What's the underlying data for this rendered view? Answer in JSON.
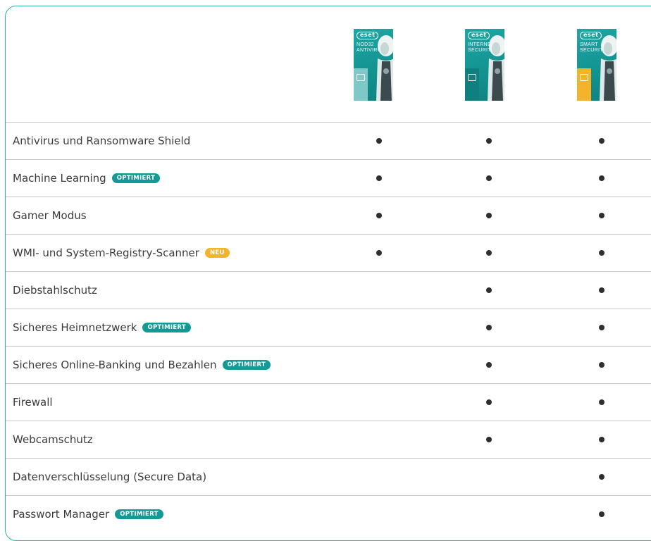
{
  "products": [
    {
      "name": "nod32",
      "logo": "eset",
      "title_lines": [
        "NOD32",
        "ANTIVIRUS"
      ],
      "strip_color": "#7fc7c8",
      "icon": "laptop-icon"
    },
    {
      "name": "internet-security",
      "logo": "eset",
      "title_lines": [
        "INTERNET",
        "SECURITY"
      ],
      "strip_color": "#0f807d",
      "icon": "shield-window-icon"
    },
    {
      "name": "smart-security",
      "logo": "eset",
      "title_lines": [
        "SMART",
        "SECURITY"
      ],
      "strip_color": "#f3b32b",
      "icon": "shield-window-icon"
    }
  ],
  "colors": {
    "accent": "#2bb2a9",
    "badge_teal": "#139a97",
    "badge_yellow": "#f3b32b"
  },
  "rows": [
    {
      "label": "Antivirus und Ransomware Shield",
      "badge": "",
      "badge_color": "",
      "marks": [
        true,
        true,
        true
      ]
    },
    {
      "label": "Machine Learning",
      "badge": "OPTIMIERT",
      "badge_color": "#139a97",
      "marks": [
        true,
        true,
        true
      ]
    },
    {
      "label": "Gamer Modus",
      "badge": "",
      "badge_color": "",
      "marks": [
        true,
        true,
        true
      ]
    },
    {
      "label": "WMI- und System-Registry-Scanner",
      "badge": "NEU",
      "badge_color": "#f3b32b",
      "marks": [
        true,
        true,
        true
      ]
    },
    {
      "label": "Diebstahlschutz",
      "badge": "",
      "badge_color": "",
      "marks": [
        false,
        true,
        true
      ]
    },
    {
      "label": "Sicheres Heimnetzwerk",
      "badge": "OPTIMIERT",
      "badge_color": "#139a97",
      "marks": [
        false,
        true,
        true
      ]
    },
    {
      "label": "Sicheres Online-Banking und Bezahlen",
      "badge": "OPTIMIERT",
      "badge_color": "#139a97",
      "marks": [
        false,
        true,
        true
      ]
    },
    {
      "label": "Firewall",
      "badge": "",
      "badge_color": "",
      "marks": [
        false,
        true,
        true
      ]
    },
    {
      "label": "Webcamschutz",
      "badge": "",
      "badge_color": "",
      "marks": [
        false,
        true,
        true
      ]
    },
    {
      "label": "Datenverschlüsselung (Secure Data)",
      "badge": "",
      "badge_color": "",
      "marks": [
        false,
        false,
        true
      ]
    },
    {
      "label": "Passwort Manager",
      "badge": "OPTIMIERT",
      "badge_color": "#139a97",
      "marks": [
        false,
        false,
        true
      ]
    }
  ]
}
